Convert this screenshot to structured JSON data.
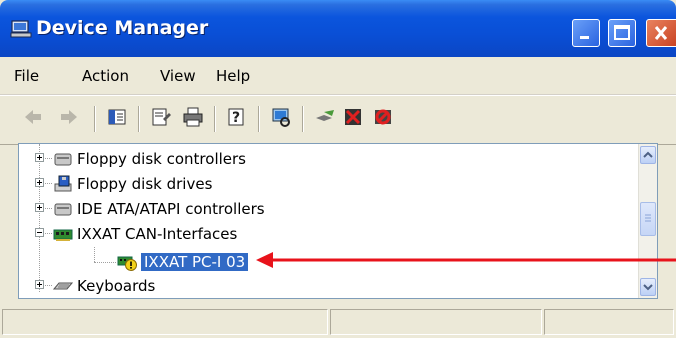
{
  "window": {
    "title": "Device Manager",
    "title_bar_color": "#0a4fd6"
  },
  "menubar": {
    "items": [
      {
        "label": "File"
      },
      {
        "label": "Action"
      },
      {
        "label": "View"
      },
      {
        "label": "Help"
      }
    ]
  },
  "toolbar": {
    "icons": [
      "back-arrow-icon",
      "forward-arrow-icon",
      "show-hide-console-tree-icon",
      "properties-icon",
      "print-icon",
      "help-icon",
      "scan-hardware-icon",
      "update-driver-icon",
      "disable-device-icon",
      "uninstall-device-icon"
    ]
  },
  "tree": {
    "items": [
      {
        "label": "Floppy disk controllers",
        "icon": "floppy-controller-icon",
        "expanded": false
      },
      {
        "label": "Floppy disk drives",
        "icon": "floppy-drive-icon",
        "expanded": false
      },
      {
        "label": "IDE ATA/ATAPI controllers",
        "icon": "ide-controller-icon",
        "expanded": false
      },
      {
        "label": "IXXAT CAN-Interfaces",
        "icon": "can-interface-icon",
        "expanded": true
      },
      {
        "label": "IXXAT PC-I 03",
        "icon": "can-device-warning-icon",
        "selected": true
      },
      {
        "label": "Keyboards",
        "icon": "keyboard-icon",
        "expanded": false
      }
    ],
    "selection_color": "#316ac5"
  },
  "annotation": {
    "arrow_color": "#e8131b"
  }
}
